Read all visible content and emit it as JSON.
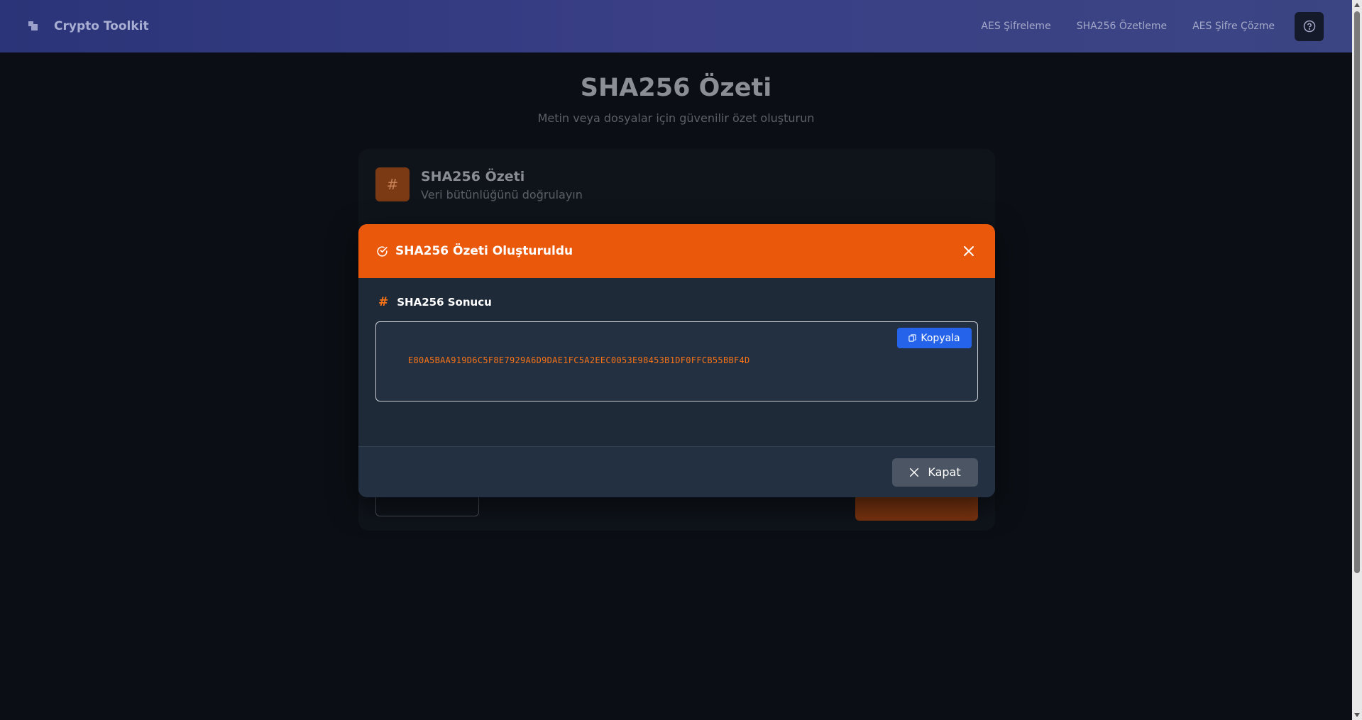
{
  "header": {
    "app_title": "Crypto Toolkit",
    "nav": [
      "AES Şifreleme",
      "SHA256 Özetleme",
      "AES Şifre Çözme"
    ]
  },
  "page": {
    "title": "SHA256 Özeti",
    "subtitle": "Metin veya dosyalar için güvenilir özet oluşturun"
  },
  "card": {
    "badge": "#",
    "title": "SHA256 Özeti",
    "subtitle": "Veri bütünlüğünü doğrulayın"
  },
  "modal": {
    "title": "SHA256 Özeti Oluşturuldu",
    "result_label": "SHA256 Sonucu",
    "hash_symbol": "#",
    "copy_label": "Kopyala",
    "hash_value": "E80A5BAA919D6C5F8E7929A6D9DAE1FC5A2EEC0053E98453B1DF0FFCB55BBF4D",
    "close_label": "Kapat"
  },
  "colors": {
    "accent": "#ea580c",
    "copy": "#2563eb",
    "header_start": "#2b3478"
  }
}
